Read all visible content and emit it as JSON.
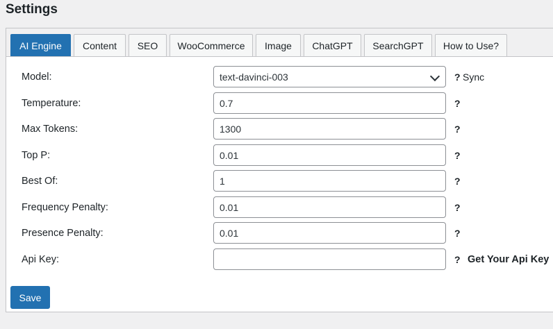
{
  "page": {
    "title": "Settings"
  },
  "tabs": [
    {
      "label": "AI Engine",
      "active": true
    },
    {
      "label": "Content"
    },
    {
      "label": "SEO"
    },
    {
      "label": "WooCommerce"
    },
    {
      "label": "Image"
    },
    {
      "label": "ChatGPT"
    },
    {
      "label": "SearchGPT"
    },
    {
      "label": "How to Use?"
    }
  ],
  "form": {
    "model": {
      "label": "Model:",
      "value": "text-davinci-003",
      "help": "?",
      "sync": "Sync"
    },
    "temperature": {
      "label": "Temperature:",
      "value": "0.7",
      "help": "?"
    },
    "max_tokens": {
      "label": "Max Tokens:",
      "value": "1300",
      "help": "?"
    },
    "top_p": {
      "label": "Top P:",
      "value": "0.01",
      "help": "?"
    },
    "best_of": {
      "label": "Best Of:",
      "value": "1",
      "help": "?"
    },
    "frequency_penalty": {
      "label": "Frequency Penalty:",
      "value": "0.01",
      "help": "?"
    },
    "presence_penalty": {
      "label": "Presence Penalty:",
      "value": "0.01",
      "help": "?"
    },
    "api_key": {
      "label": "Api Key:",
      "value": "",
      "help": "?",
      "link": "Get Your Api Key"
    }
  },
  "actions": {
    "save_label": "Save"
  },
  "colors": {
    "accent": "#2271b1",
    "background": "#f0f0f1",
    "border": "#c3c4c7"
  }
}
